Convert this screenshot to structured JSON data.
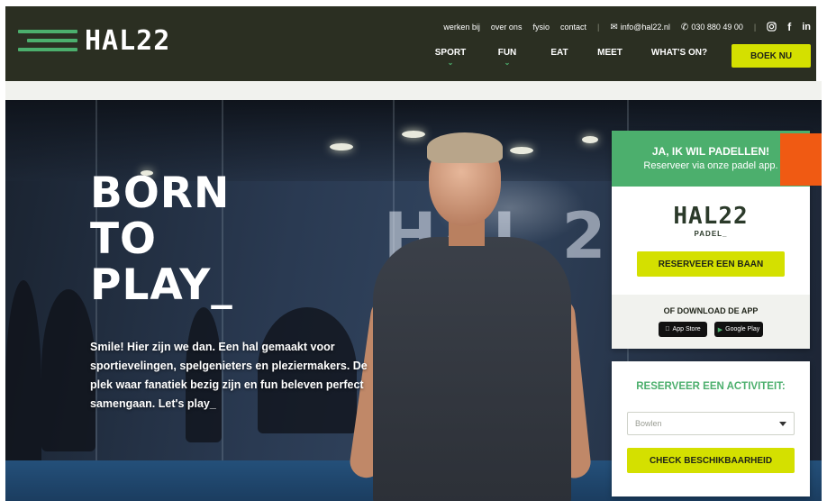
{
  "brand": {
    "logo_text": "HAL22",
    "accent": "#4caf6d",
    "yellow": "#d4e000",
    "dark": "#2b2f22"
  },
  "top_links": [
    {
      "label": "werken bij"
    },
    {
      "label": "over ons"
    },
    {
      "label": "fysio"
    },
    {
      "label": "contact"
    }
  ],
  "contact": {
    "email": "info@hal22.nl",
    "phone": "030 880 49 00",
    "email_icon": "mail-icon",
    "phone_icon": "phone-icon"
  },
  "social": {
    "instagram": "instagram-icon",
    "facebook_glyph": "f",
    "linkedin_glyph": "in"
  },
  "main_nav": [
    {
      "label": "SPORT",
      "has_dropdown": true
    },
    {
      "label": "FUN",
      "has_dropdown": true
    },
    {
      "label": "EAT",
      "has_dropdown": false
    },
    {
      "label": "MEET",
      "has_dropdown": false
    },
    {
      "label": "WHAT'S ON?",
      "has_dropdown": false
    }
  ],
  "boek_button": "BOEK NU",
  "hero": {
    "title_lines": [
      "BORN",
      "TO",
      "PLAY_"
    ],
    "text": "Smile! Hier zijn we dan. Een hal gemaakt voor sportievelingen, spelgenieters en pleziermakers. De plek waar fanatiek bezig zijn en fun beleven perfect samengaan. Let's play_",
    "wall_text": "HAL 22"
  },
  "padel_card": {
    "heading": "JA, IK WIL PADELLEN!",
    "subheading": "Reserveer via onze padel app.",
    "logo_main": "HAL22",
    "logo_sub": "PADEL_",
    "reserve_button": "RESERVEER EEN BAAN",
    "download_label": "OF DOWNLOAD DE APP",
    "app_store": "App Store",
    "google_play": "Google Play"
  },
  "activity_card": {
    "heading": "RESERVEER EEN ACTIVITEIT:",
    "selected_value": "Bowlen",
    "check_button": "CHECK BESCHIKBAARHEID"
  }
}
